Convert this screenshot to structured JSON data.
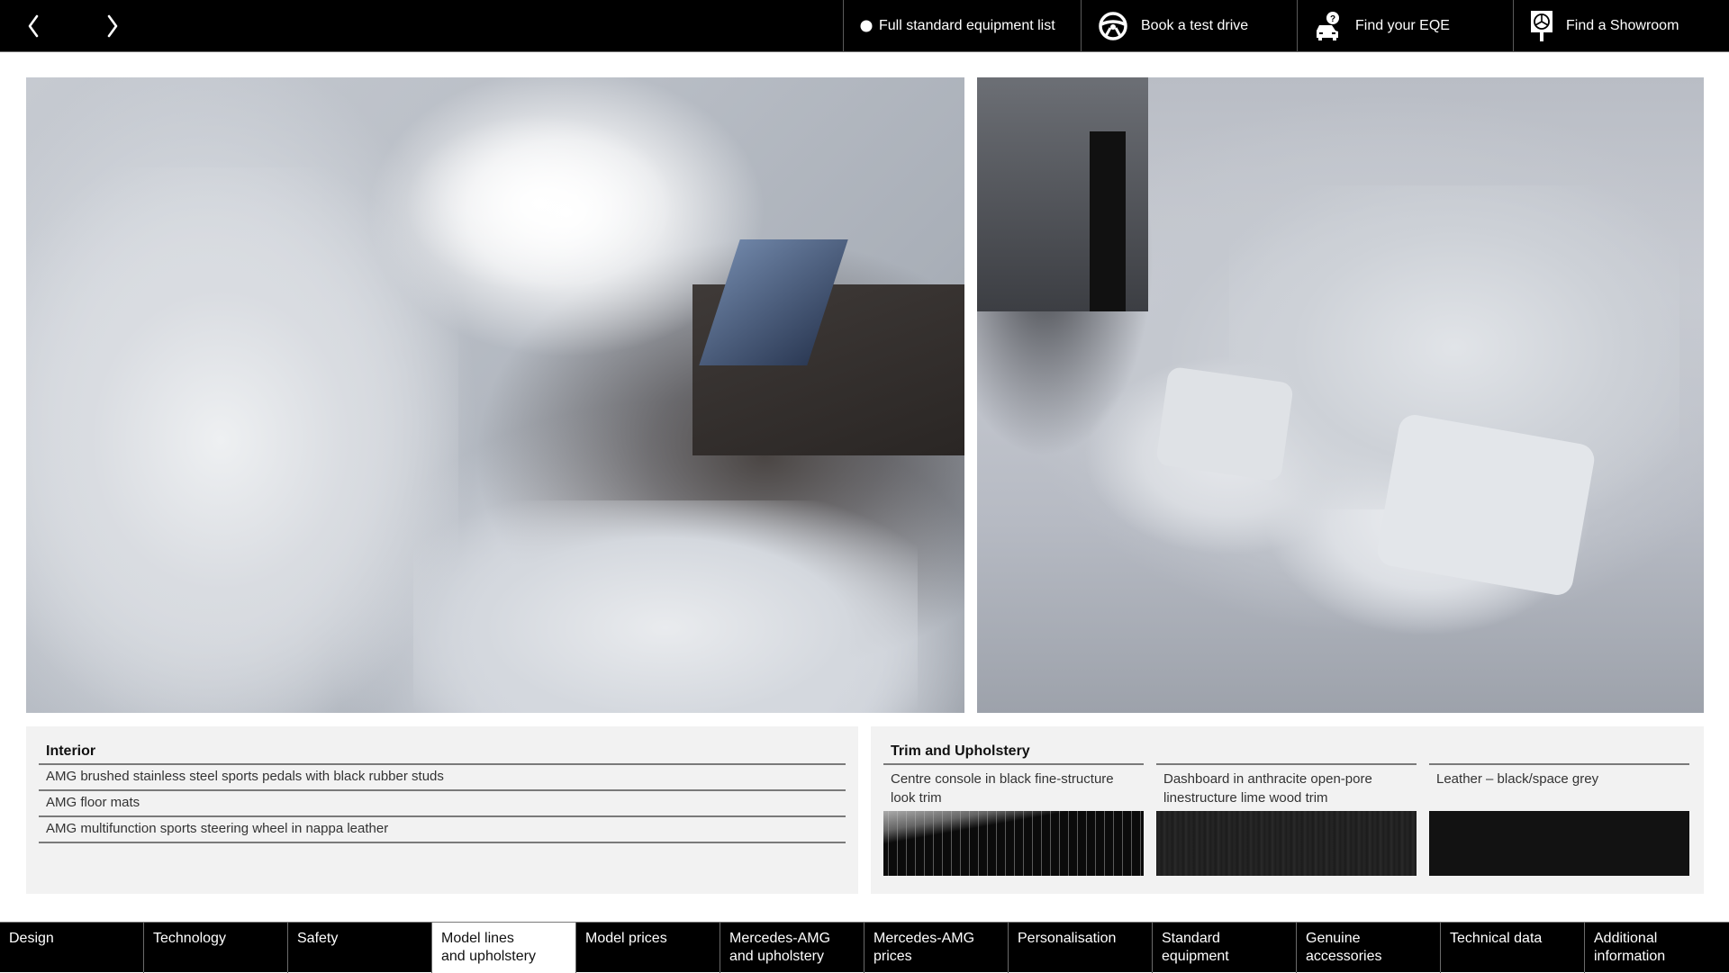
{
  "topbar": {
    "prev_icon": "chevron-left-icon",
    "next_icon": "chevron-right-icon",
    "actions": [
      {
        "label": "Full standard equipment list",
        "icon": "dot-icon"
      },
      {
        "label": "Book a test drive",
        "icon": "steering-wheel-icon"
      },
      {
        "label": "Find your EQE",
        "icon": "car-question-icon"
      },
      {
        "label": "Find a Showroom",
        "icon": "showroom-sign-icon"
      }
    ]
  },
  "photos": [
    {
      "alt": "Front interior cabin with light grey seats and dashboard displays",
      "name": "front-interior-photo"
    },
    {
      "alt": "Rear interior bench seat with light grey leather and cushions",
      "name": "rear-interior-photo"
    }
  ],
  "interior": {
    "title": "Interior",
    "items": [
      "AMG brushed stainless steel sports pedals with black rubber studs",
      "AMG floor mats",
      "AMG multifunction sports steering wheel in nappa leather"
    ]
  },
  "trim": {
    "title": "Trim and Upholstery",
    "options": [
      {
        "label": "Centre console in black fine-structure look trim",
        "swatch_color": "#0b0b0b"
      },
      {
        "label": "Dashboard in anthracite open-pore linestructure lime wood trim",
        "swatch_color": "#222222"
      },
      {
        "label": "Leather – black/space grey",
        "swatch_color": "#121212"
      }
    ]
  },
  "bottom_nav": {
    "active_index": 3,
    "tabs": [
      {
        "line1": "Design",
        "line2": ""
      },
      {
        "line1": "Technology",
        "line2": ""
      },
      {
        "line1": "Safety",
        "line2": ""
      },
      {
        "line1": "Model lines",
        "line2": "and upholstery"
      },
      {
        "line1": "Model prices",
        "line2": ""
      },
      {
        "line1": "Mercedes-AMG",
        "line2": "and upholstery"
      },
      {
        "line1": "Mercedes-AMG",
        "line2": "prices"
      },
      {
        "line1": "Personalisation",
        "line2": ""
      },
      {
        "line1": "Standard",
        "line2": "equipment"
      },
      {
        "line1": "Genuine",
        "line2": "accessories"
      },
      {
        "line1": "Technical data",
        "line2": ""
      },
      {
        "line1": "Additional",
        "line2": "information"
      }
    ]
  },
  "colors": {
    "bar_background": "#000000",
    "panel_background": "#f2f2f2",
    "active_tab_background": "#ffffff",
    "divider": "#7a7a7a"
  }
}
